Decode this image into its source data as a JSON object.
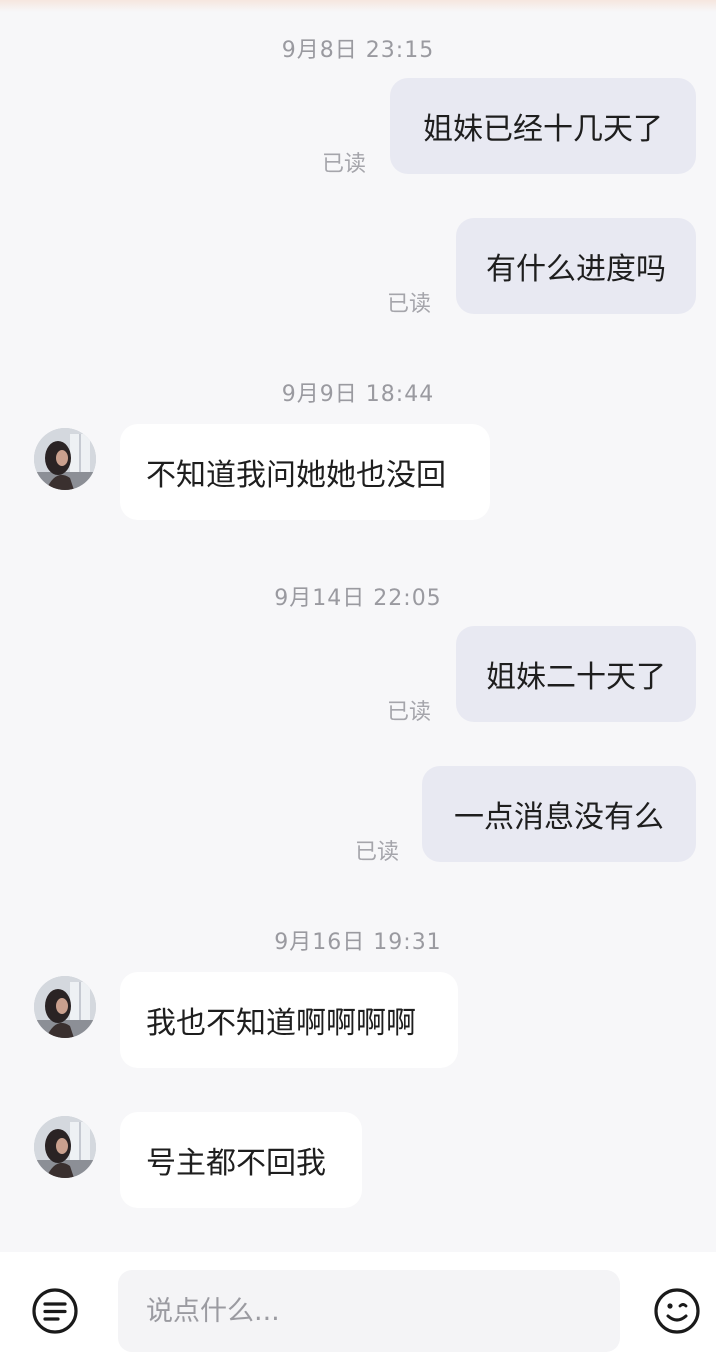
{
  "conversation": {
    "groups": [
      {
        "timestamp": "9月8日 23:15",
        "messages": [
          {
            "from": "me",
            "text": "姐妹已经十几天了",
            "status": "已读"
          },
          {
            "from": "me",
            "text": "有什么进度吗",
            "status": "已读"
          }
        ]
      },
      {
        "timestamp": "9月9日 18:44",
        "messages": [
          {
            "from": "other",
            "text": "不知道我问她她也没回"
          }
        ]
      },
      {
        "timestamp": "9月14日 22:05",
        "messages": [
          {
            "from": "me",
            "text": "姐妹二十天了",
            "status": "已读"
          },
          {
            "from": "me",
            "text": "一点消息没有么",
            "status": "已读"
          }
        ]
      },
      {
        "timestamp": "9月16日 19:31",
        "messages": [
          {
            "from": "other",
            "text": "我也不知道啊啊啊啊"
          },
          {
            "from": "other",
            "text": "号主都不回我"
          }
        ]
      }
    ]
  },
  "input_bar": {
    "placeholder": "说点什么...",
    "menu_icon": "menu-lines-icon",
    "emoji_icon": "emoji-smile-icon"
  },
  "colors": {
    "outgoing_bubble": "#e8e9f2",
    "incoming_bubble": "#ffffff",
    "background": "#f7f7f9",
    "timestamp_text": "#9a9aa0",
    "read_text": "#a5a5ab"
  }
}
